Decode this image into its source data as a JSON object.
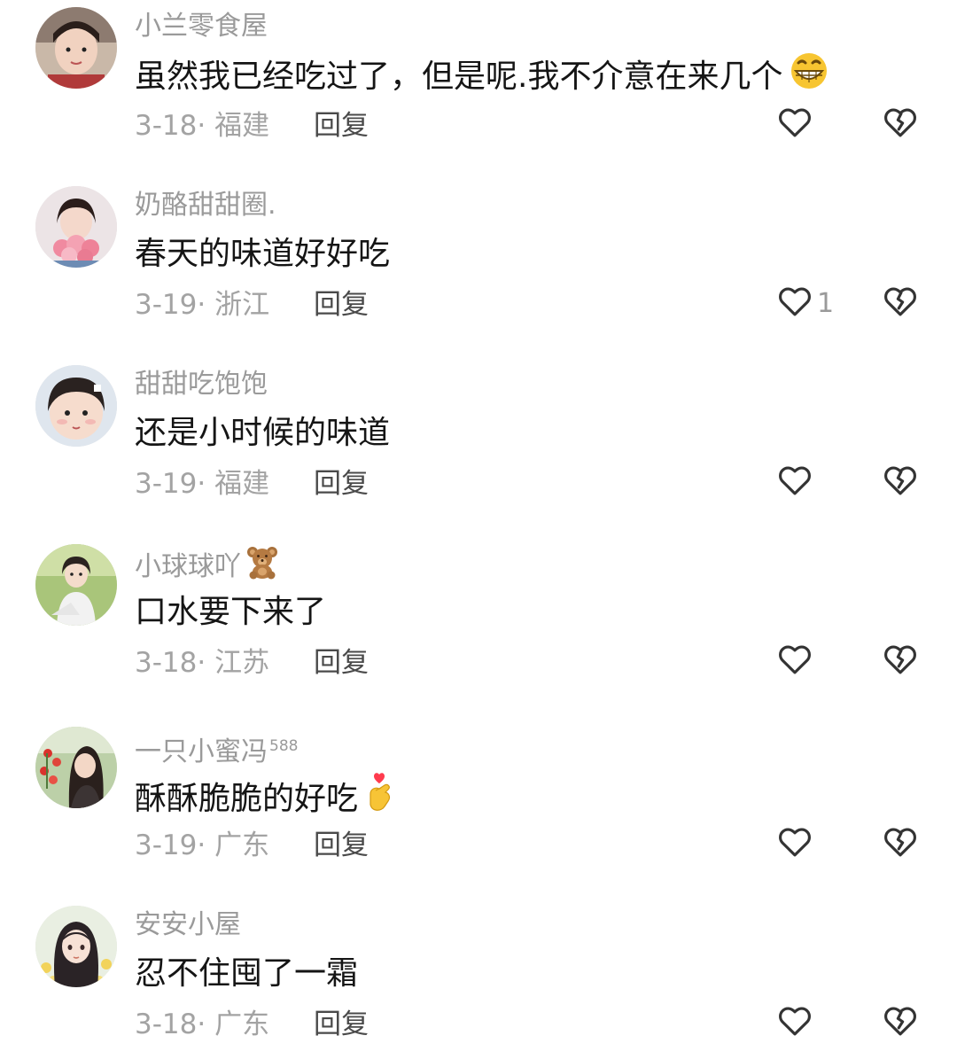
{
  "comments": [
    {
      "username": "小兰零食屋",
      "text": "虽然我已经吃过了，但是呢.我不介意在来几个",
      "text_emoji": "grin-emoji",
      "date": "3-18",
      "location": "福建",
      "reply_label": "回复",
      "like_count": ""
    },
    {
      "username": "奶酪甜甜圈.",
      "text": "春天的味道好好吃",
      "date": "3-19",
      "location": "浙江",
      "reply_label": "回复",
      "like_count": "1"
    },
    {
      "username": "甜甜吃饱饱",
      "text": "还是小时候的味道",
      "date": "3-19",
      "location": "福建",
      "reply_label": "回复",
      "like_count": ""
    },
    {
      "username": "小球球吖",
      "username_emoji": "teddy-bear-emoji",
      "text": "口水要下来了",
      "date": "3-18",
      "location": "江苏",
      "reply_label": "回复",
      "like_count": ""
    },
    {
      "username": "一只小蜜冯",
      "username_badge": "588",
      "text": "酥酥脆脆的好吃",
      "text_emoji": "finger-heart-emoji",
      "date": "3-19",
      "location": "广东",
      "reply_label": "回复",
      "like_count": ""
    },
    {
      "username": "安安小屋",
      "text": "忍不住囤了一霜",
      "date": "3-18",
      "location": "广东",
      "reply_label": "回复",
      "like_count": ""
    }
  ],
  "meta_separator": "· ",
  "icons": {
    "like": "heart-outline-icon",
    "dislike": "broken-heart-icon"
  },
  "colors": {
    "username": "#9a9a9a",
    "text": "#151515",
    "meta": "#a3a3a3",
    "reply": "#4a4a4a",
    "icon_stroke": "#333333"
  }
}
